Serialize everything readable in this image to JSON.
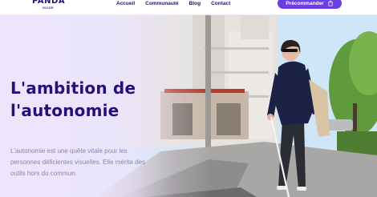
{
  "header": {
    "logo": {
      "main": "PANDA",
      "sub": "GUIDE"
    },
    "nav": [
      "Accueil",
      "Communauté",
      "Blog",
      "Contact"
    ],
    "cta_label": "Précommander",
    "cta_icon": "shopping-bag-icon"
  },
  "hero": {
    "title_line1": "L'ambition de",
    "title_line2": "l'autonomie",
    "text": "L'autonomie est une quête vitale pour les personnes déficientes visuelles. Elle mérite des outils hors du commun.",
    "photo": "woman-walking-with-white-cane-photo"
  },
  "colors": {
    "brand": "#2a0c7a",
    "accent": "#6b3fe2",
    "overlay": "#ece5fb",
    "body_text": "#8a86a8"
  }
}
